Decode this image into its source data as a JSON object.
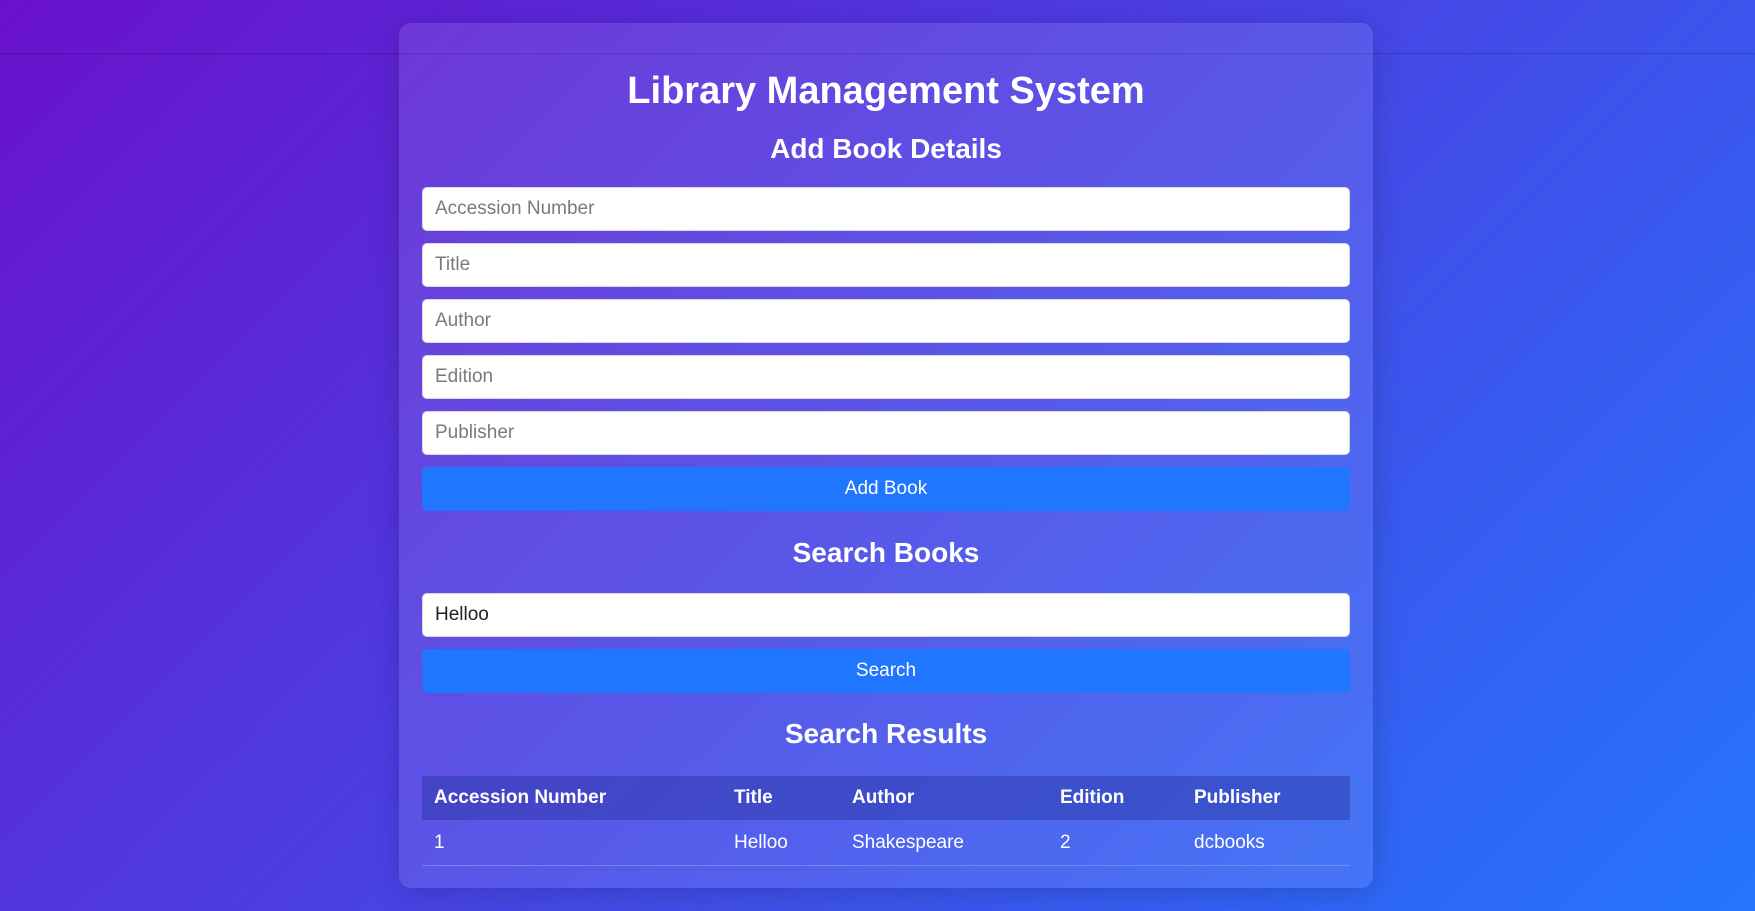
{
  "app": {
    "title": "Library Management System"
  },
  "add_section": {
    "heading": "Add Book Details",
    "fields": {
      "accession_placeholder": "Accession Number",
      "title_placeholder": "Title",
      "author_placeholder": "Author",
      "edition_placeholder": "Edition",
      "publisher_placeholder": "Publisher"
    },
    "button_label": "Add Book"
  },
  "search_section": {
    "heading": "Search Books",
    "query_value": "Helloo",
    "button_label": "Search"
  },
  "results_section": {
    "heading": "Search Results",
    "columns": {
      "accession": "Accession Number",
      "title": "Title",
      "author": "Author",
      "edition": "Edition",
      "publisher": "Publisher"
    },
    "rows": [
      {
        "accession": "1",
        "title": "Helloo",
        "author": "Shakespeare",
        "edition": "2",
        "publisher": "dcbooks"
      }
    ]
  },
  "colors": {
    "accent": "#2176ff",
    "gradient_start": "#6a11cb",
    "gradient_end": "#2575fc"
  }
}
